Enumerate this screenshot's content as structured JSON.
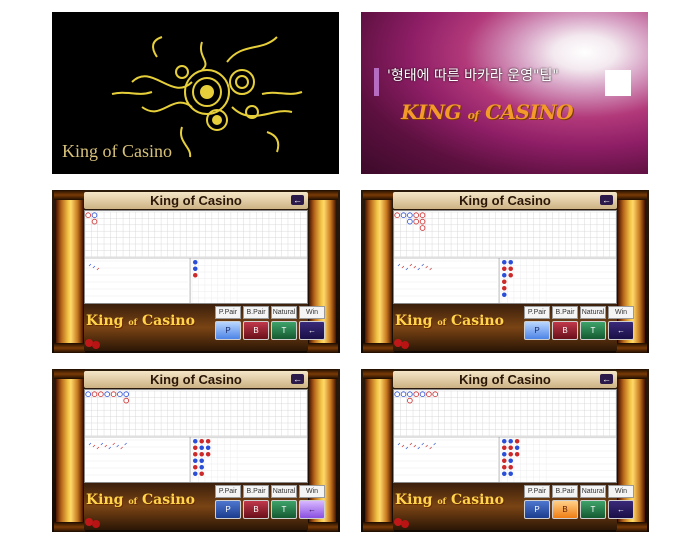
{
  "logo_tile": {
    "title": "King of Casino"
  },
  "promo_tile": {
    "text": "'형태에 따른 바카라 운영\"팁\"",
    "logo_main": "KING",
    "logo_of": "of",
    "logo_casino": "CASINO"
  },
  "game": {
    "title": "King of Casino",
    "back_icon": "arrow-left-icon",
    "brand_main": "King",
    "brand_of": "of",
    "brand_casino": "Casino",
    "pair_buttons": [
      "P.Pair",
      "B.Pair",
      "Natural",
      "Win"
    ],
    "bet_buttons": [
      "P",
      "B",
      "T",
      "←"
    ],
    "colors": {
      "player": "#2a4fd6",
      "banker": "#cc2a2a",
      "tie": "#2e9e55"
    }
  },
  "screens": [
    {
      "big_road": [
        {
          "c": 0,
          "r": 0,
          "s": "B"
        },
        {
          "c": 1,
          "r": 0,
          "s": "P"
        },
        {
          "c": 1,
          "r": 1,
          "s": "B"
        }
      ],
      "bead": [
        "P",
        "P",
        "B"
      ],
      "selected": "P"
    },
    {
      "big_road": [
        {
          "c": 0,
          "r": 0,
          "s": "B"
        },
        {
          "c": 1,
          "r": 0,
          "s": "P"
        },
        {
          "c": 2,
          "r": 0,
          "s": "P"
        },
        {
          "c": 2,
          "r": 1,
          "s": "P"
        },
        {
          "c": 3,
          "r": 0,
          "s": "B"
        },
        {
          "c": 3,
          "r": 1,
          "s": "B"
        },
        {
          "c": 4,
          "r": 0,
          "s": "B"
        },
        {
          "c": 4,
          "r": 1,
          "s": "B"
        },
        {
          "c": 4,
          "r": 2,
          "s": "B"
        }
      ],
      "bead": [
        "P",
        "B",
        "P",
        "B",
        "B",
        "P",
        "P",
        "B",
        "B"
      ],
      "selected": "P"
    },
    {
      "big_road": [
        {
          "c": 0,
          "r": 0,
          "s": "P"
        },
        {
          "c": 1,
          "r": 0,
          "s": "B"
        },
        {
          "c": 2,
          "r": 0,
          "s": "B"
        },
        {
          "c": 3,
          "r": 0,
          "s": "P"
        },
        {
          "c": 4,
          "r": 0,
          "s": "B"
        },
        {
          "c": 5,
          "r": 0,
          "s": "P"
        },
        {
          "c": 6,
          "r": 0,
          "s": "P"
        },
        {
          "c": 6,
          "r": 1,
          "s": "B"
        }
      ],
      "bead": [
        "P",
        "B",
        "B",
        "P",
        "B",
        "P",
        "B",
        "P",
        "B",
        "P",
        "P",
        "B",
        "B",
        "P",
        "B"
      ],
      "selected": "←"
    },
    {
      "big_road": [
        {
          "c": 0,
          "r": 0,
          "s": "P"
        },
        {
          "c": 1,
          "r": 0,
          "s": "P"
        },
        {
          "c": 2,
          "r": 0,
          "s": "P"
        },
        {
          "c": 2,
          "r": 1,
          "s": "B"
        },
        {
          "c": 3,
          "r": 0,
          "s": "B"
        },
        {
          "c": 4,
          "r": 0,
          "s": "P"
        },
        {
          "c": 5,
          "r": 0,
          "s": "B"
        },
        {
          "c": 6,
          "r": 0,
          "s": "B"
        }
      ],
      "bead": [
        "P",
        "B",
        "P",
        "B",
        "B",
        "P",
        "P",
        "B",
        "B",
        "P",
        "B",
        "P",
        "B",
        "P",
        "B"
      ],
      "selected": "B"
    }
  ]
}
